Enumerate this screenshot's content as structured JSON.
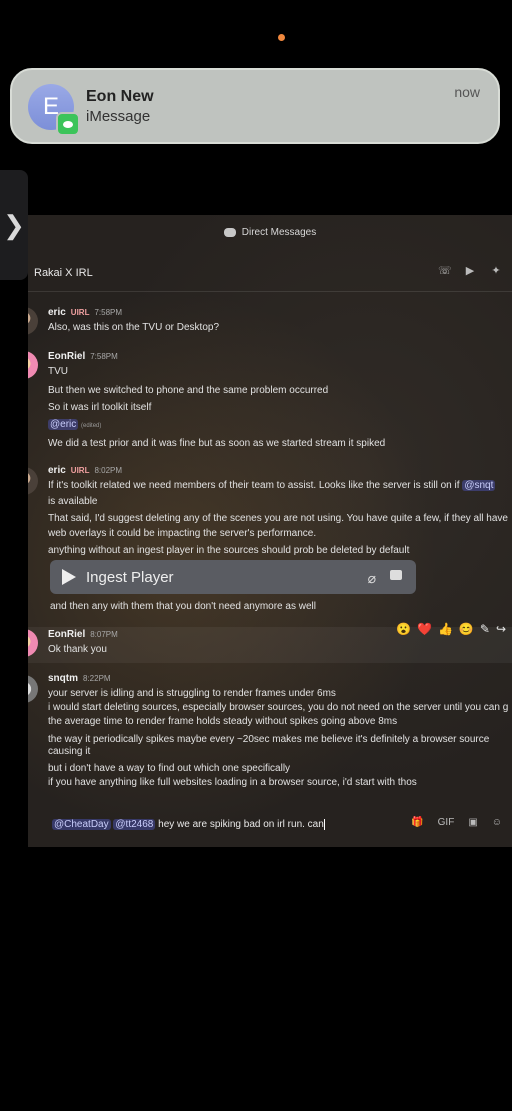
{
  "notification": {
    "avatar_letter": "E",
    "title": "Eon New",
    "subtitle": "iMessage",
    "time": "now"
  },
  "handle": {
    "glyph": "❯"
  },
  "discord": {
    "top_title": "Direct Messages",
    "channel": "Rakai X IRL",
    "messages": [
      {
        "author": "eric",
        "tag": "UIRL",
        "time": "7:58PM",
        "lines": [
          "Also, was this on the TVU or Desktop?"
        ]
      },
      {
        "author": "EonRiel",
        "time": "7:58PM",
        "lines": [
          "TVU",
          "But then we switched to phone and the same problem occurred",
          "So it was irl toolkit itself"
        ],
        "mention_line": {
          "mention": "@eric",
          "edited": "(edited)"
        },
        "after": "We did a test prior and it was fine but as soon as we started stream it spiked"
      },
      {
        "author": "eric",
        "tag": "UIRL",
        "time": "8:02PM",
        "line1": "If it's toolkit related we need members of their team to assist.  Looks like the server is still on if",
        "line1_mention": "@snqt",
        "lines": [
          "is available",
          "That said, I'd suggest deleting any of the scenes you are not using. You have quite a few, if they all have",
          "web overlays it could be impacting the server's performance.",
          "anything without an ingest player in the sources should prob be deleted by default"
        ],
        "embed_label": "Ingest Player",
        "after": "and then any with them that you don't need anymore as well"
      },
      {
        "author": "EonRiel",
        "time": "8:07PM",
        "lines": [
          "Ok thank you"
        ]
      },
      {
        "author": "snqtm",
        "time": "8:22PM",
        "lines": [
          "your server is idling and is struggling to render frames under 6ms",
          "i would start deleting sources, especially browser sources, you do not need on the server until you can g",
          "the average time to render frame holds steady without spikes going above 8ms",
          "the way it periodically spikes maybe every ~20sec makes me believe it's definitely a browser source",
          "causing it",
          "but i don't have a way to find out which one specifically",
          "if you have anything like full websites loading in a browser source, i'd start with thos"
        ]
      }
    ],
    "reactions": [
      "😮",
      "❤️",
      "👍",
      "😊",
      "✎",
      "↪"
    ],
    "composer": {
      "mention1": "@CheatDay",
      "mention2": "@tt2468",
      "text": "hey we are spiking bad on irl run. can"
    },
    "composer_tools": [
      "🎁",
      "GIF",
      "▣",
      "☺"
    ]
  }
}
